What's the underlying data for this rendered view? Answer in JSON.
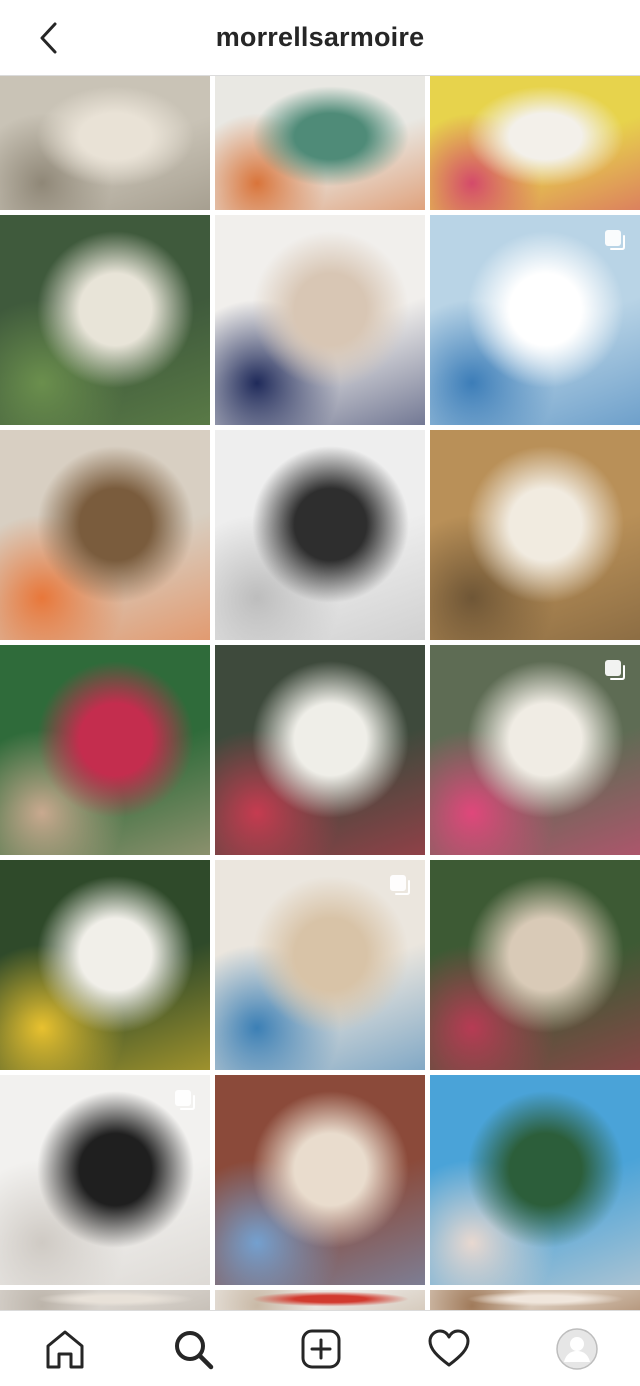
{
  "header": {
    "username": "morrellsarmoire",
    "back_icon": "chevron-left-icon"
  },
  "grid": {
    "posts": [
      {
        "row": 0,
        "col": 0,
        "colors": [
          "#c9c3b6",
          "#e9e2d6",
          "#8f8777"
        ],
        "multi": false
      },
      {
        "row": 0,
        "col": 1,
        "colors": [
          "#e9e8e3",
          "#4f8b78",
          "#d9743a"
        ],
        "multi": false
      },
      {
        "row": 0,
        "col": 2,
        "colors": [
          "#e7d34c",
          "#f3f0ea",
          "#d44a6a"
        ],
        "multi": false
      },
      {
        "row": 1,
        "col": 0,
        "colors": [
          "#3f5a3c",
          "#e8e4d8",
          "#6b8f4d"
        ],
        "multi": false
      },
      {
        "row": 1,
        "col": 1,
        "colors": [
          "#f1efec",
          "#d8c6b4",
          "#1f2a5a"
        ],
        "multi": false
      },
      {
        "row": 1,
        "col": 2,
        "colors": [
          "#b9d4e6",
          "#ffffff",
          "#3c7db8"
        ],
        "multi": true
      },
      {
        "row": 2,
        "col": 0,
        "colors": [
          "#d8cfc2",
          "#7a5c3d",
          "#e8773a"
        ],
        "multi": false
      },
      {
        "row": 2,
        "col": 1,
        "colors": [
          "#eeeeee",
          "#2e2e2e",
          "#bdbdbd"
        ],
        "multi": false
      },
      {
        "row": 2,
        "col": 2,
        "colors": [
          "#b99058",
          "#f1ebe0",
          "#6f5636"
        ],
        "multi": false
      },
      {
        "row": 3,
        "col": 0,
        "colors": [
          "#2f6b3a",
          "#c42d4e",
          "#c9a98f"
        ],
        "multi": false
      },
      {
        "row": 3,
        "col": 1,
        "colors": [
          "#3e4a3c",
          "#efeee8",
          "#c63b50"
        ],
        "multi": false
      },
      {
        "row": 3,
        "col": 2,
        "colors": [
          "#5e6c54",
          "#f0ece4",
          "#e0477b"
        ],
        "multi": true
      },
      {
        "row": 4,
        "col": 0,
        "colors": [
          "#2f4a2a",
          "#f1efe9",
          "#e8c12f"
        ],
        "multi": false
      },
      {
        "row": 4,
        "col": 1,
        "colors": [
          "#ebe6de",
          "#d8c3a7",
          "#3b7fb5"
        ],
        "multi": true
      },
      {
        "row": 4,
        "col": 2,
        "colors": [
          "#3d5a34",
          "#d9cab7",
          "#b73b54"
        ],
        "multi": false
      },
      {
        "row": 5,
        "col": 0,
        "colors": [
          "#f2f1ef",
          "#1f1f1f",
          "#cfcac4"
        ],
        "multi": true
      },
      {
        "row": 5,
        "col": 1,
        "colors": [
          "#8b4a3a",
          "#e9dccd",
          "#74a0cf"
        ],
        "multi": false
      },
      {
        "row": 5,
        "col": 2,
        "colors": [
          "#4aa3d8",
          "#2c5e3a",
          "#e8d8d0"
        ],
        "multi": false
      },
      {
        "row": 6,
        "col": 0,
        "colors": [
          "#d9d4ce",
          "#e8e1d8",
          "#bcb4aa"
        ],
        "multi": false
      },
      {
        "row": 6,
        "col": 1,
        "colors": [
          "#eae6e1",
          "#d23a2e",
          "#c9b9a6"
        ],
        "multi": false
      },
      {
        "row": 6,
        "col": 2,
        "colors": [
          "#d8c8b8",
          "#f0e6dc",
          "#a07a5a"
        ],
        "multi": false
      }
    ]
  },
  "bottom_nav": {
    "items": [
      {
        "name": "home-icon"
      },
      {
        "name": "search-icon"
      },
      {
        "name": "new-post-icon"
      },
      {
        "name": "activity-heart-icon"
      },
      {
        "name": "profile-avatar-icon"
      }
    ]
  }
}
